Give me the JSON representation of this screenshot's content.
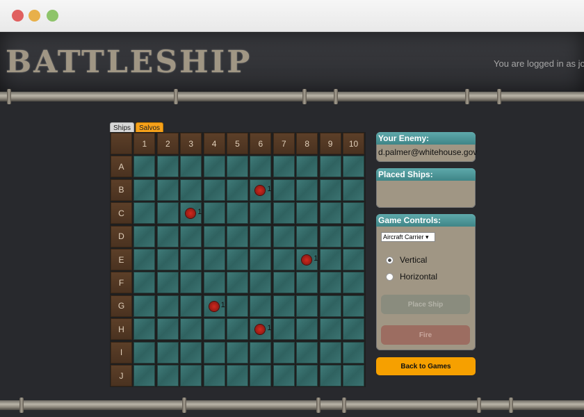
{
  "app": {
    "title": "BATTLESHIP",
    "login_text": "You are logged in as jordi"
  },
  "tabs": [
    {
      "label": "Ships"
    },
    {
      "label": "Salvos"
    }
  ],
  "board": {
    "columns": [
      "1",
      "2",
      "3",
      "4",
      "5",
      "6",
      "7",
      "8",
      "9",
      "10"
    ],
    "rows": [
      "A",
      "B",
      "C",
      "D",
      "E",
      "F",
      "G",
      "H",
      "I",
      "J"
    ],
    "hits": [
      {
        "row": "B",
        "col": "6",
        "turn": "1"
      },
      {
        "row": "C",
        "col": "3",
        "turn": "1"
      },
      {
        "row": "E",
        "col": "8",
        "turn": "1"
      },
      {
        "row": "G",
        "col": "4",
        "turn": "1"
      },
      {
        "row": "H",
        "col": "6",
        "turn": "1"
      }
    ]
  },
  "enemy": {
    "title": "Your Enemy:",
    "value": "d.palmer@whitehouse.gov"
  },
  "placed": {
    "title": "Placed Ships:"
  },
  "controls": {
    "title": "Game Controls:",
    "ship_select": "Aircraft Carrier",
    "vertical_label": "Vertical",
    "horizontal_label": "Horizontal",
    "place_label": "Place Ship",
    "fire_label": "Fire"
  },
  "back_label": "Back to Games",
  "colors": {
    "accent": "#f6a000",
    "panel": "#a09684",
    "header_teal": "#3f8587"
  }
}
